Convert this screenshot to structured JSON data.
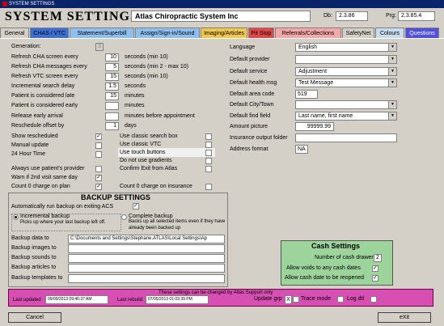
{
  "window": {
    "title": "SYSTEM SETTINGS"
  },
  "header": {
    "title": "SYSTEM SETTINGS",
    "organization": "Atlas Chiropractic System Inc",
    "db_label": "Db:",
    "db_value": "2.3.86",
    "prg_label": "Prg:",
    "prg_value": "2.3.85.4"
  },
  "tabs": [
    {
      "label": "General",
      "color": "#d4d0c8"
    },
    {
      "label": "CHAS / VTC",
      "color": "#3b6fd6"
    },
    {
      "label": "Statement/Superbill",
      "color": "#8fbfef"
    },
    {
      "label": "Assign/Sign-in/Sound",
      "color": "#8fbfef"
    },
    {
      "label": "Imaging/Articles",
      "color": "#f2c84b"
    },
    {
      "label": "Pit Stop",
      "color": "#e04848"
    },
    {
      "label": "Referrals/Collections",
      "color": "#f4a8a8"
    },
    {
      "label": "SafetyNet",
      "color": "#d4d0c8"
    },
    {
      "label": "Colours",
      "color": "#c8dcf0"
    },
    {
      "label": "Questions",
      "color": "#5050e0"
    }
  ],
  "left": {
    "generation_label": "Generation:",
    "generation_value": "3",
    "refresh_cha_label": "Refresh CHA screen every",
    "refresh_cha_value": "10",
    "refresh_cha_note": "seconds (min 10)",
    "refresh_cha_msg_label": "Refresh CHA messages every",
    "refresh_cha_msg_value": "5",
    "refresh_cha_msg_note": "seconds (min 2 - max 10)",
    "refresh_vtc_label": "Refresh VTC screen every",
    "refresh_vtc_value": "15",
    "refresh_vtc_note": "seconds (min 10)",
    "search_delay_label": "Incremental search delay",
    "search_delay_value": "1.5",
    "search_delay_note": "seconds",
    "late_label": "Patient is considered late",
    "late_value": "15",
    "late_note": "minutes",
    "early_label": "Patient is considered early",
    "early_note": "minutes",
    "release_label": "Release early arrival",
    "release_note": "minutes before appointment",
    "reschedule_label": "Reschedule offset by",
    "reschedule_value": "1",
    "reschedule_note": "days",
    "show_rescheduled": "Show rescheduled",
    "manual_update": "Manual update",
    "hour24": "24 Hour Time",
    "always_use_provider": "Always use patient's provider",
    "warn_2nd": "Warn if 2nd visit same day",
    "count0_plan": "Count 0 charge on plan"
  },
  "middle": {
    "classic_search": "Use classic search box",
    "classic_vtc": "Use classic VTC",
    "touch_buttons": "Use touch buttons",
    "no_gradients": "Do not use gradients",
    "confirm_exit": "Confirm Exit from Atlas",
    "count0_insurance": "Count 0 charge on insurance"
  },
  "right": {
    "language_label": "Language",
    "language_value": "English",
    "provider_label": "Default provider",
    "provider_value": "",
    "service_label": "Default service",
    "service_value": "Adjustment",
    "health_msg_label": "Default health msg",
    "health_msg_value": "Test Message",
    "area_code_label": "Default area code",
    "area_code_value": "519",
    "city_label": "Default City/Town",
    "city_value": "",
    "find_field_label": "Default find field",
    "find_field_value": "Last name, first name",
    "amount_label": "Amount picture",
    "amount_value": "99999.99",
    "insurance_label": "Insurance output folder",
    "insurance_value": "",
    "address_label": "Address format",
    "address_value": "NA"
  },
  "backup": {
    "heading": "BACKUP SETTINGS",
    "auto_run": "Automatically run backup on exiting ACS",
    "incremental": "Incremental backup",
    "incremental_desc": "Picks up where your last backup left off.",
    "complete": "Complete backup",
    "complete_desc": "Backs up all selected items even if they have already been backed up",
    "data_to_label": "Backup data to",
    "data_to_value": "C:\\Documents and Settings\\Stephane.ATLAS\\Local Settings\\Ap",
    "images_to_label": "Backup images to",
    "sounds_to_label": "Backup sounds to",
    "articles_to_label": "Backup articles to",
    "templates_to_label": "Backup templates to"
  },
  "cash": {
    "heading": "Cash Settings",
    "drawers_label": "Number of cash drawers",
    "drawers_value": "2",
    "voids_label": "Allow voids to any cash dates",
    "reopen_label": "Allow cash date to be reopened"
  },
  "footer": {
    "notice": "These settings can be changed by Atlas Support only",
    "last_updated_label": "Last updated",
    "last_updated_value": "09/09/2013 09:46:37 AM",
    "last_rebuild_label": "Last rebuild",
    "last_rebuild_value": "07/05/2013 01:03:39 PM",
    "update_grp_label": "Update grp",
    "update_grp_value": "X",
    "trace_mode_label": "Trace mode",
    "log_dtl_label": "Log dtl"
  },
  "buttons": {
    "cancel": "Cancel",
    "exit": "eXit"
  }
}
